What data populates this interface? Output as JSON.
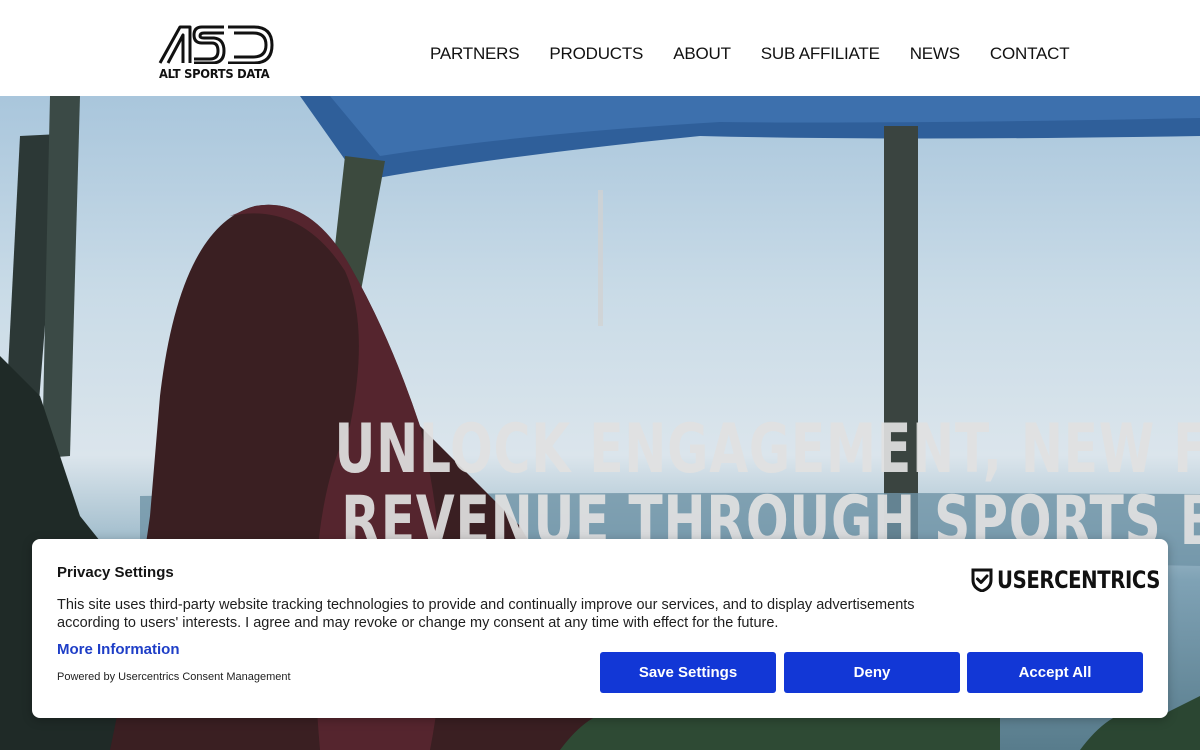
{
  "header": {
    "logo_letters": "ASD",
    "logo_text": "ALT SPORTS DATA",
    "nav": [
      {
        "label": "PARTNERS"
      },
      {
        "label": "PRODUCTS"
      },
      {
        "label": "ABOUT"
      },
      {
        "label": "SUB AFFILIATE"
      },
      {
        "label": "NEWS"
      },
      {
        "label": "CONTACT"
      }
    ]
  },
  "hero": {
    "title_line1": "UNLOCK ENGAGEMENT, NEW FANS &",
    "title_line2": "REVENUE THROUGH SPORTS BETTING"
  },
  "consent": {
    "title": "Privacy Settings",
    "text": "This site uses third-party website tracking technologies to provide and continually improve our services, and to display advertisements according to users' interests. I agree and may revoke or change my consent at any time with effect for the future.",
    "more_info": "More Information",
    "powered_by": "Powered by Usercentrics Consent Management",
    "brand": "USERCENTRICS",
    "buttons": {
      "save": "Save Settings",
      "deny": "Deny",
      "accept": "Accept All"
    }
  },
  "colors": {
    "button_bg": "#1237d6",
    "link": "#1e3ec7",
    "hero_sky": "#c9dbe7"
  }
}
